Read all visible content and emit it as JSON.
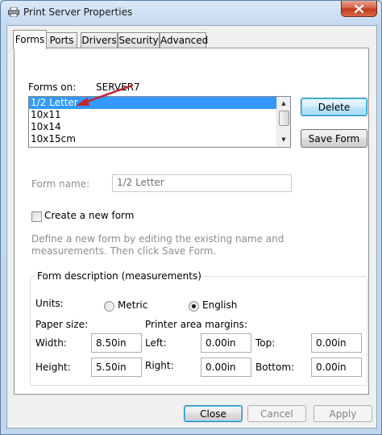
{
  "window": {
    "title": "Print Server Properties"
  },
  "tabs": [
    {
      "label": "Forms"
    },
    {
      "label": "Ports"
    },
    {
      "label": "Drivers"
    },
    {
      "label": "Security"
    },
    {
      "label": "Advanced"
    }
  ],
  "forms_on": {
    "label": "Forms on:",
    "server": "SERVER7"
  },
  "forms_list": {
    "items": [
      "1/2 Letter",
      "10x11",
      "10x14",
      "10x15cm"
    ],
    "selected": "1/2 Letter"
  },
  "buttons": {
    "delete": "Delete",
    "save_form": "Save Form",
    "close": "Close",
    "cancel": "Cancel",
    "apply": "Apply"
  },
  "form_name": {
    "label": "Form name:",
    "value": "1/2 Letter"
  },
  "create_new": {
    "label": "Create a new form",
    "checked": false
  },
  "hint": {
    "line1": "Define a new form by editing the existing name and",
    "line2": "measurements. Then click Save Form."
  },
  "description": {
    "title": "Form description (measurements)",
    "units_label": "Units:",
    "units": {
      "metric": "Metric",
      "english": "English",
      "selected": "English"
    },
    "paper_size_label": "Paper size:",
    "margins_label": "Printer area margins:",
    "width_label": "Width:",
    "width_value": "8.50in",
    "height_label": "Height:",
    "height_value": "5.50in",
    "left_label": "Left:",
    "left_value": "0.00in",
    "right_label": "Right:",
    "right_value": "0.00in",
    "top_label": "Top:",
    "top_value": "0.00in",
    "bottom_label": "Bottom:",
    "bottom_value": "0.00in"
  },
  "colors": {
    "selection": "#3399ff",
    "annotation_arrow": "#c0282d"
  }
}
